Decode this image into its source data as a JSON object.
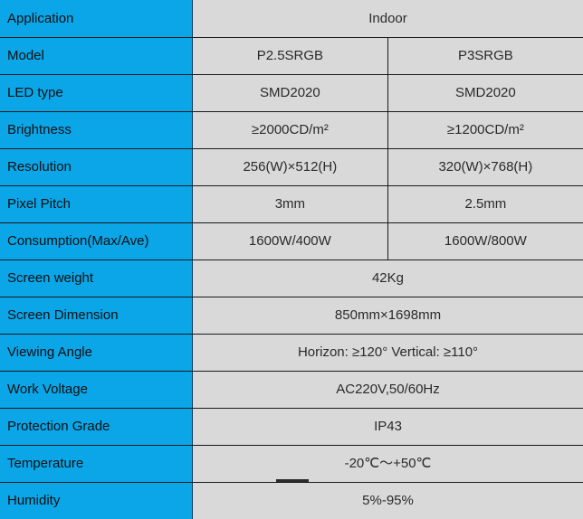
{
  "table": {
    "theme": {
      "label_bg": "#0aa6e8",
      "value_bg": "#d9d9d9",
      "border": "#1a1a1a",
      "label_border": "#103a56",
      "text": "#1c1c1c"
    },
    "rows": [
      {
        "label": "Application",
        "span": true,
        "value": "Indoor",
        "values": []
      },
      {
        "label": "Model",
        "span": false,
        "value": "",
        "values": [
          "P2.5SRGB",
          "P3SRGB"
        ]
      },
      {
        "label": "LED type",
        "span": false,
        "value": "",
        "values": [
          "SMD2020",
          "SMD2020"
        ]
      },
      {
        "label": "Brightness",
        "span": false,
        "value": "",
        "values": [
          "≥2000CD/m²",
          "≥1200CD/m²"
        ]
      },
      {
        "label": "Resolution",
        "span": false,
        "value": "",
        "values": [
          "256(W)×512(H)",
          "320(W)×768(H)"
        ]
      },
      {
        "label": "Pixel Pitch",
        "span": false,
        "value": "",
        "values": [
          "3mm",
          "2.5mm"
        ]
      },
      {
        "label": "Consumption(Max/Ave)",
        "span": false,
        "value": "",
        "values": [
          "1600W/400W",
          "1600W/800W"
        ]
      },
      {
        "label": "Screen weight",
        "span": true,
        "value": "42Kg",
        "values": []
      },
      {
        "label": "Screen Dimension",
        "span": true,
        "value": "850mm×1698mm",
        "values": []
      },
      {
        "label": "Viewing Angle",
        "span": true,
        "value": "Horizon: ≥120° Vertical: ≥110°",
        "values": []
      },
      {
        "label": "Work Voltage",
        "span": true,
        "value": "AC220V,50/60Hz",
        "values": []
      },
      {
        "label": "Protection Grade",
        "span": true,
        "value": "IP43",
        "values": []
      },
      {
        "label": "Temperature",
        "span": true,
        "value": "-20℃～+50℃",
        "values": []
      },
      {
        "label": "Humidity",
        "span": true,
        "value": "5%-95%",
        "values": []
      }
    ]
  }
}
